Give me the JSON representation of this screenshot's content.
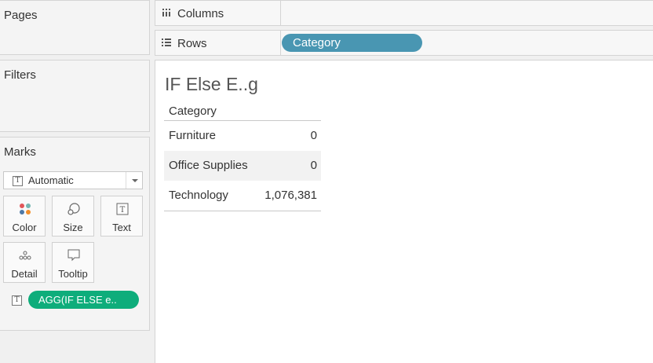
{
  "pages": {
    "title": "Pages"
  },
  "filters": {
    "title": "Filters"
  },
  "marks": {
    "title": "Marks",
    "mark_type": "Automatic",
    "buttons": {
      "color": "Color",
      "size": "Size",
      "text": "Text",
      "detail": "Detail",
      "tooltip": "Tooltip"
    },
    "pill": "AGG(IF ELSE e.."
  },
  "shelves": {
    "columns_label": "Columns",
    "rows_label": "Rows",
    "rows_pill": "Category"
  },
  "viz": {
    "title": "IF Else E..g",
    "table": {
      "header": "Category",
      "rows": [
        {
          "category": "Furniture",
          "value": "0"
        },
        {
          "category": "Office Supplies",
          "value": "0"
        },
        {
          "category": "Technology",
          "value": "1,076,381"
        }
      ]
    }
  },
  "colors": {
    "rows_pill": "#4996b2",
    "marks_pill": "#0ead7b"
  }
}
